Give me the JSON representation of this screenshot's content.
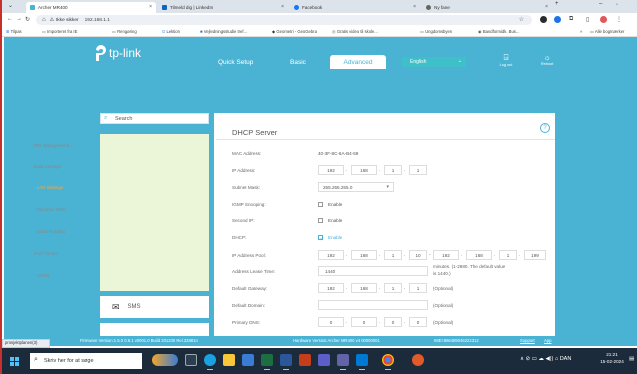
{
  "browser": {
    "tabs": [
      {
        "label": "Archer MR400",
        "active": true,
        "color": "#4ab3d4"
      },
      {
        "label": "Tilmeld dig | LinkedIn",
        "active": false,
        "color": "#0a66c2"
      },
      {
        "label": "Facebook",
        "active": false,
        "color": "#1877f2"
      },
      {
        "label": "Ny fane",
        "active": false,
        "color": "#555555"
      }
    ],
    "new_tab": "+",
    "address": {
      "security_label": "Ikke sikker",
      "url": "192.168.1.1"
    },
    "bookmarks": [
      "Tilpas",
      "Importeret fra IE",
      "Rengøring",
      "Lektion",
      "Vejledningsstudie tref...",
      "Geometri - GeoGebra",
      "Gratis video til skole...",
      "Ungdomsbyen",
      "Bandformidk. Bus..."
    ],
    "bookmarks_more": "»",
    "bookmarks_all": "Alle bogmærker"
  },
  "router": {
    "brand": "tp-link",
    "nav": {
      "quick_setup": "Quick Setup",
      "basic": "Basic",
      "advanced": "Advanced"
    },
    "language": "English",
    "logout": "Log out",
    "reboot": "Reboot",
    "search_placeholder": "Search",
    "menu": [
      "PIN Management",
      "Data Settings",
      "LAN Settings",
      "Dynamic DNS",
      "Static Routing",
      "IPv6 Tunnel",
      "USSD"
    ],
    "active_menu": "LAN Settings",
    "sms_label": "SMS",
    "section_title": "DHCP Server",
    "help": "?",
    "fields": {
      "mac_label": "MAC Address:",
      "mac_value": "40-3F-8C-6A-B4-59",
      "ip_label": "IP Address:",
      "ip": [
        "192",
        "168",
        "1",
        "1"
      ],
      "mask_label": "Subnet Mask:",
      "mask_value": "255.255.255.0",
      "igmp_label": "IGMP Snooping:",
      "igmp_text": "Enable",
      "second_ip_label": "Second IP:",
      "second_ip_text": "Enable",
      "dhcp_label": "DHCP:",
      "dhcp_text": "Enable",
      "pool_label": "IP Address Pool:",
      "pool_start": [
        "192",
        "168",
        "1",
        "10"
      ],
      "pool_end": [
        "192",
        "168",
        "1",
        "199"
      ],
      "lease_label": "Address Lease Time:",
      "lease_value": "1440",
      "lease_hint_1": "minutes. (1-2880. The default value",
      "lease_hint_2": "is 1440.)",
      "gateway_label": "Default Gateway:",
      "gateway": [
        "192",
        "168",
        "1",
        "1"
      ],
      "gateway_hint": "(Optional)",
      "domain_label": "Default Domain:",
      "domain_hint": "(Optional)",
      "dns_label": "Primary DNS:",
      "dns": [
        "0",
        "0",
        "0",
        "0"
      ],
      "dns_hint": "(Optional)"
    },
    "footer": {
      "firmware": "Firmware Version:1.5.0 0.9.1 v0001.0 Build 201230 Rel.32881n",
      "hardware": "Hardware Version:Archer MR400 v4 00000001",
      "imei": "IMEI:866489046222312",
      "support": "Support",
      "app": "App"
    }
  },
  "download_bar": "prosjektplanen(3)",
  "taskbar": {
    "search_placeholder": "Skriv her for at søge",
    "tray": "∧  ⊘  ▭  ☁  ◀))  ⌂  DAN",
    "time": "21:21",
    "date": "15-02-2024"
  }
}
